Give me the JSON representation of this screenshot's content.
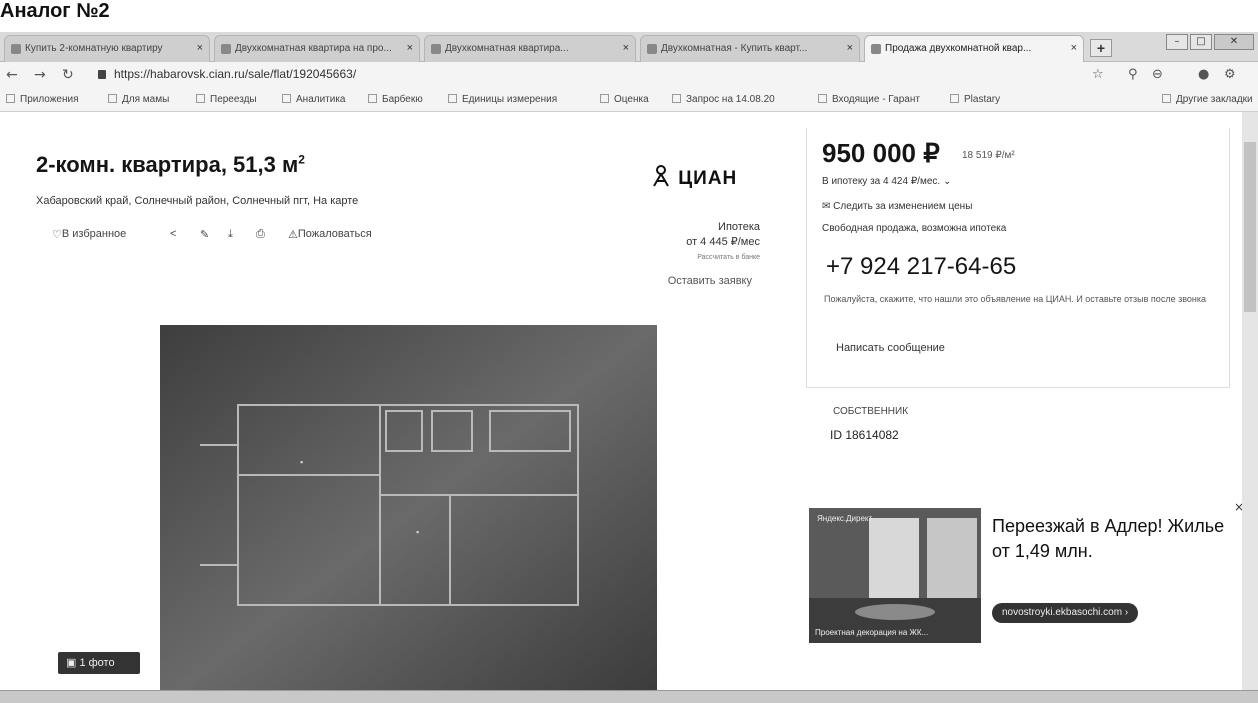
{
  "document_title": "Аналог №2",
  "browser": {
    "tabs": [
      {
        "label": "Купить 2-комнатную квартиру"
      },
      {
        "label": "Двухкомнатная квартира на про..."
      },
      {
        "label": "Двухкомнатная квартира..."
      },
      {
        "label": "Двухкомнатная - Купить кварт..."
      },
      {
        "label": "Продажа двухкомнатной квар..."
      }
    ],
    "active_tab_index": 4,
    "url": "https://habarovsk.cian.ru/sale/flat/192045663/",
    "bookmarks": [
      {
        "label": "Приложения"
      },
      {
        "label": "Для мамы"
      },
      {
        "label": "Переезды"
      },
      {
        "label": "Аналитика"
      },
      {
        "label": "Барбекю"
      },
      {
        "label": "Единицы измерения"
      },
      {
        "label": "Оценка"
      },
      {
        "label": "Запрос на 14.08.20"
      },
      {
        "label": "Входящие - Гарант"
      },
      {
        "label": "Plastary"
      },
      {
        "label": "Другие закладки"
      }
    ]
  },
  "listing": {
    "title": "2-комн. квартира, 51,3 м",
    "title_sup": "2",
    "address": "Хабаровский край, Солнечный район, Солнечный пгт, На карте",
    "actions": {
      "favorite": "В избранное",
      "complain": "Пожаловаться"
    },
    "logo_text": "ЦИАН",
    "mortgage": {
      "label": "Ипотека",
      "amount": "от 4 445 ₽/мес",
      "bank": "Рассчитать в банке"
    },
    "leave_request": "Оставить заявку",
    "photo_count": "1 фото"
  },
  "sidebar": {
    "price": "950 000 ₽",
    "price_per_m2": "18 519 ₽/м²",
    "mortgage_line": "В ипотеку за 4 424 ₽/мес.",
    "watch_price": "Следить за изменением цены",
    "sale_type": "Свободная продажа, возможна ипотека",
    "phone": "+7 924 217-64-65",
    "note": "Пожалуйста, скажите, что нашли это объявление на ЦИАН. И оставьте отзыв после звонка",
    "message_button": "Написать сообщение",
    "owner_role": "СОБСТВЕННИК",
    "owner_id": "ID 18614082"
  },
  "ad": {
    "label": "Яндекс.Директ",
    "caption": "Проектная декорация на ЖК...",
    "headline": "Переезжай в Адлер! Жилье от 1,49 млн.",
    "link": "novostroyki.ekbasochi.com ›"
  }
}
